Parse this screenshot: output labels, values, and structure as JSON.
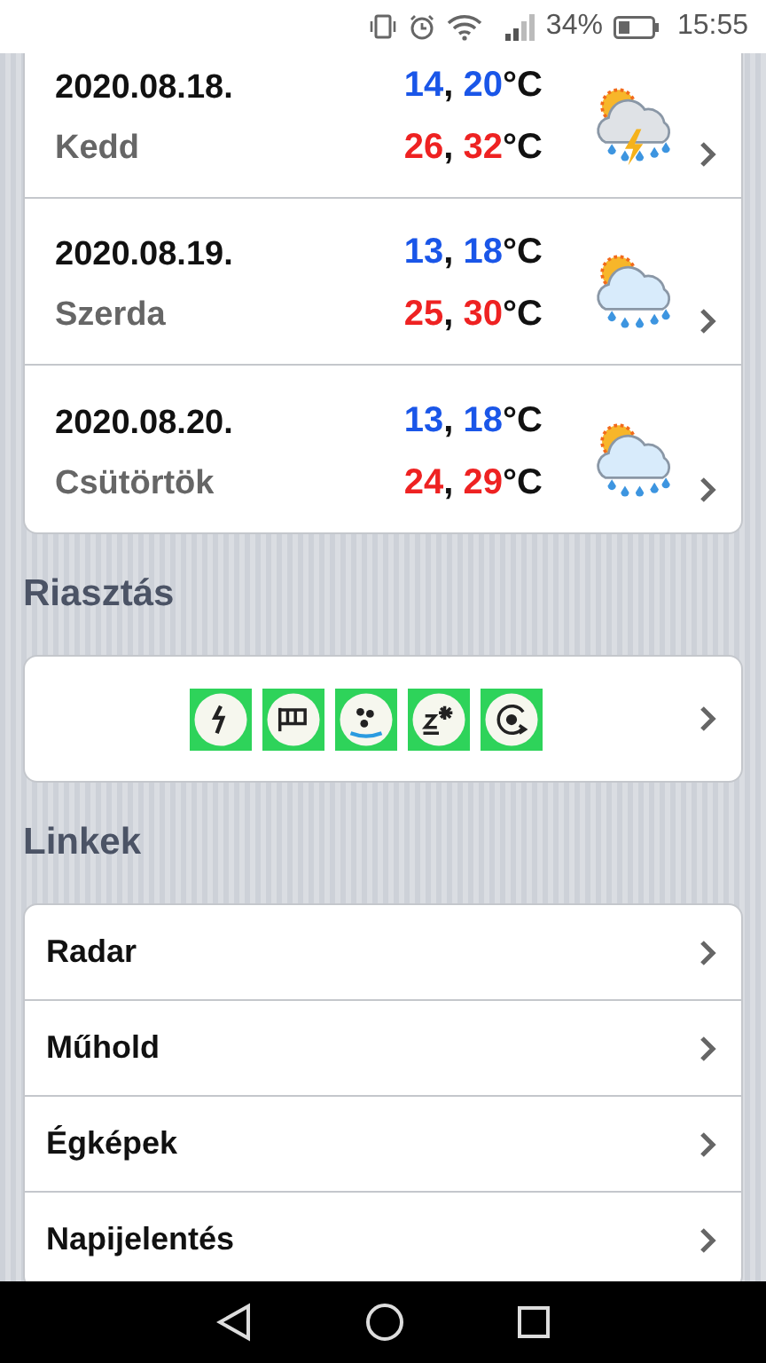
{
  "status_bar": {
    "battery": "34%",
    "time": "15:55"
  },
  "forecast": [
    {
      "kind": "thunder",
      "date": "2020.08.18.",
      "day": "Kedd",
      "min": {
        "values": [
          "14",
          "20"
        ],
        "separator": ",",
        "unit": "°C"
      },
      "max": {
        "values": [
          "26",
          "32"
        ],
        "separator": ",",
        "unit": "°C"
      }
    },
    {
      "kind": "rain",
      "date": "2020.08.19.",
      "day": "Szerda",
      "min": {
        "values": [
          "13",
          "18"
        ],
        "separator": ",",
        "unit": "°C"
      },
      "max": {
        "values": [
          "25",
          "30"
        ],
        "separator": ",",
        "unit": "°C"
      }
    },
    {
      "kind": "rain",
      "date": "2020.08.20.",
      "day": "Csütörtök",
      "min": {
        "values": [
          "13",
          "18"
        ],
        "separator": ",",
        "unit": "°C"
      },
      "max": {
        "values": [
          "24",
          "29"
        ],
        "separator": ",",
        "unit": "°C"
      }
    }
  ],
  "alerts_heading": "Riasztás",
  "alerts": [
    {
      "kind": "lightning",
      "color": "#2ed35a"
    },
    {
      "kind": "wind",
      "color": "#2ed35a"
    },
    {
      "kind": "rain",
      "color": "#2ed35a"
    },
    {
      "kind": "snow",
      "color": "#2ed35a"
    },
    {
      "kind": "storm",
      "color": "#2ed35a"
    }
  ],
  "links_heading": "Linkek",
  "links": [
    "Radar",
    "Műhold",
    "Égképek",
    "Napijelentés"
  ]
}
